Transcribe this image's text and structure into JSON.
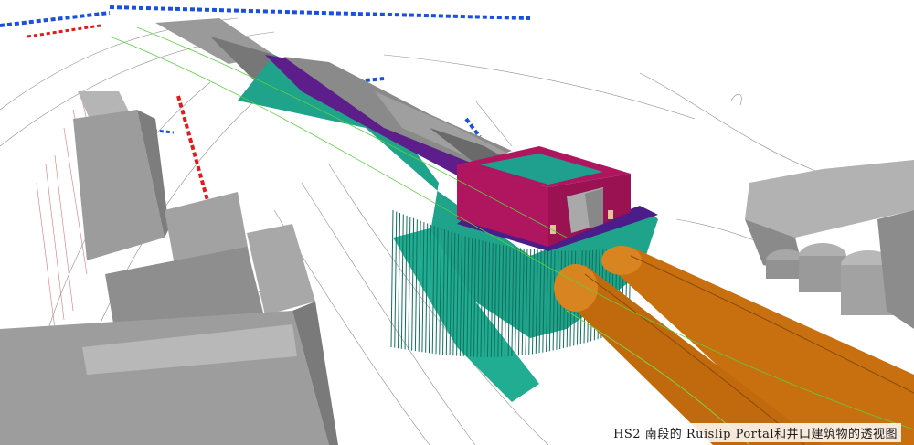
{
  "caption": "HS2 南段的 Ruislip Portal和井口建筑物的透视图",
  "colors": {
    "background": "#ffffff",
    "piles": "#1fa38a",
    "pile_dark": "#0f6f5c",
    "headhouse_roof": "#1f9f8e",
    "headhouse_wall": "#b0155f",
    "slab": "#4a1d8a",
    "tunnel": "#c8700f",
    "tunnel_dark": "#8a4a08",
    "buildings": "#9a9a9a",
    "survey_blue": "#1b4fe0",
    "survey_red": "#e01b1b"
  },
  "icons": {
    "tunnel": "tbm-tunnel-pipe",
    "headhouse": "headhouse-building",
    "piles": "secant-pile-wall"
  }
}
